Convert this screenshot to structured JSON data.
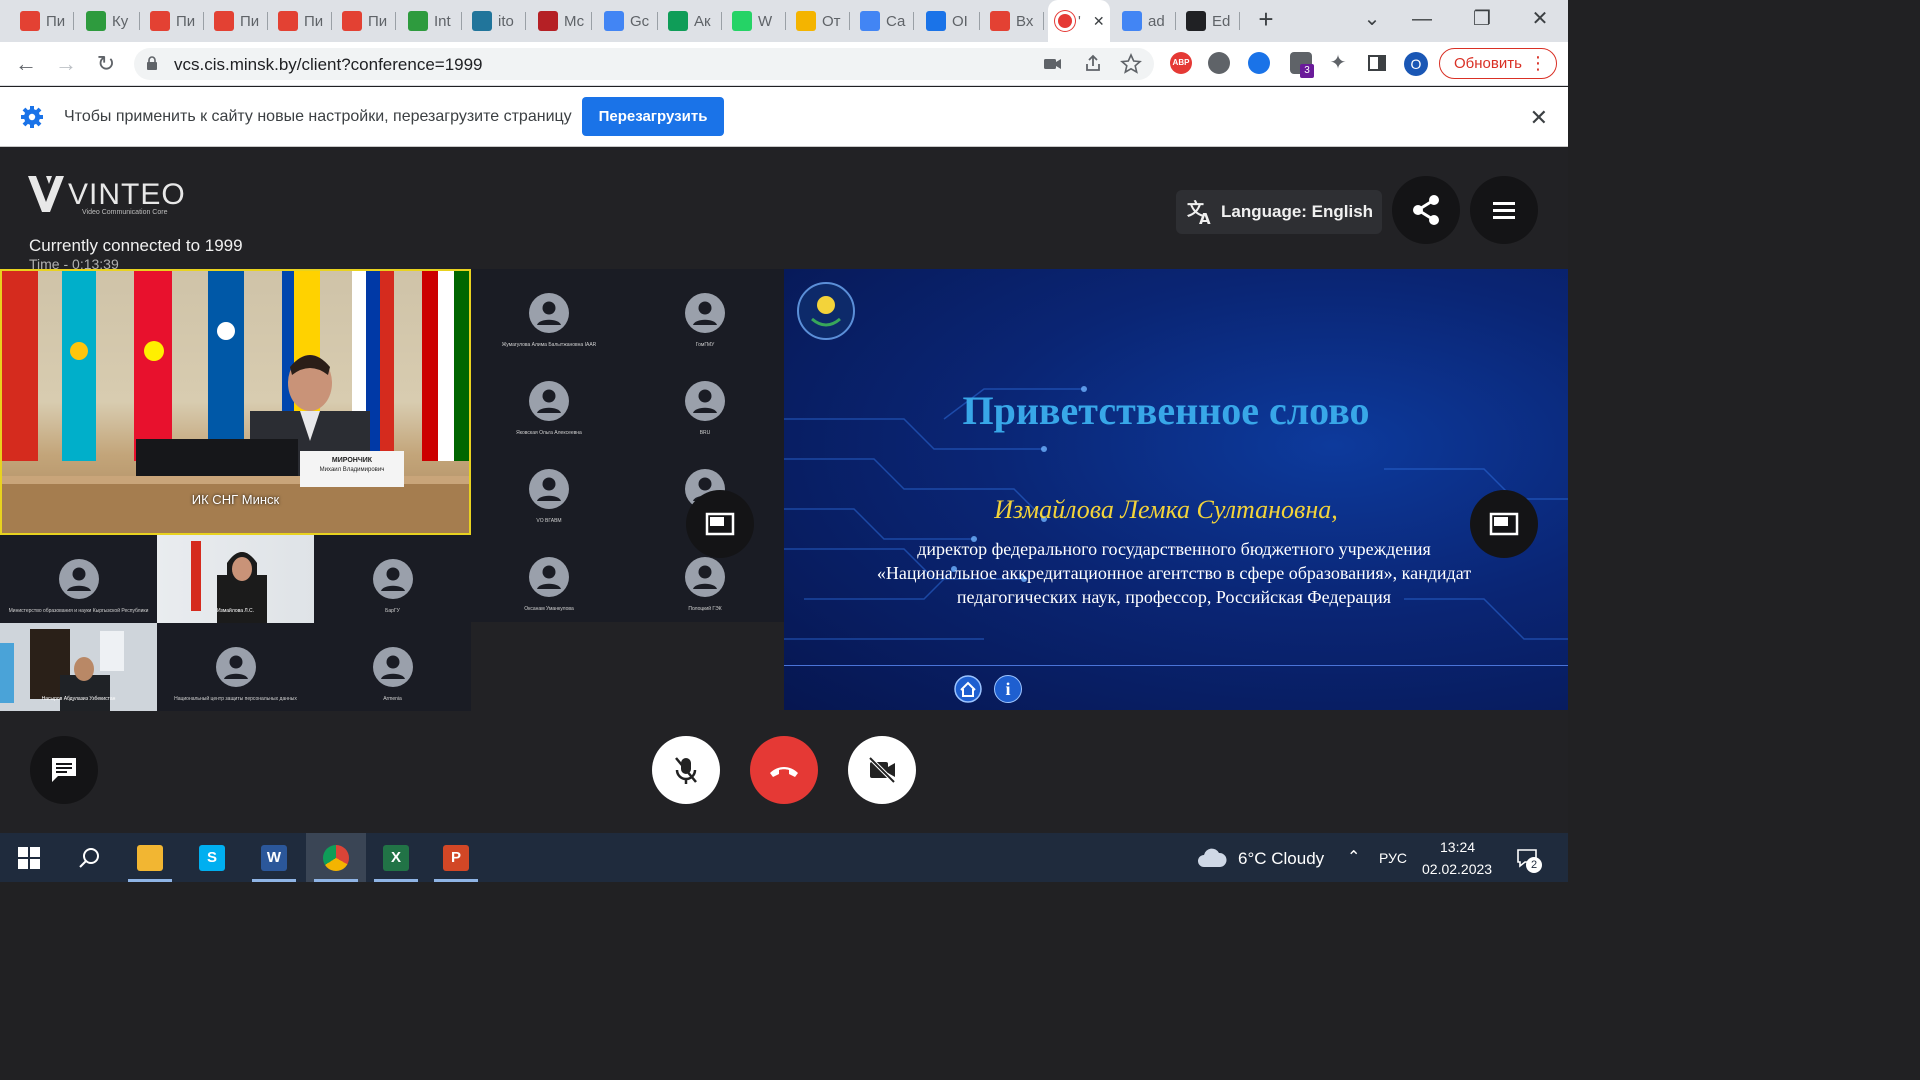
{
  "browser": {
    "tabs": [
      {
        "title": "Пи",
        "icon": "gmail-icon",
        "color": "#e34133"
      },
      {
        "title": "Ку",
        "icon": "flower-icon",
        "color": "#2e9b3e"
      },
      {
        "title": "Пи",
        "icon": "gmail-icon",
        "color": "#e34133"
      },
      {
        "title": "Пи",
        "icon": "gmail-icon",
        "color": "#e34133"
      },
      {
        "title": "Пи",
        "icon": "gmail-icon",
        "color": "#e34133"
      },
      {
        "title": "Пи",
        "icon": "gmail-icon",
        "color": "#e34133"
      },
      {
        "title": "Int",
        "icon": "flower-icon",
        "color": "#2e9b3e"
      },
      {
        "title": "ito",
        "icon": "wordpress-icon",
        "color": "#21759b"
      },
      {
        "title": "Мс",
        "icon": "building-icon",
        "color": "#b52025"
      },
      {
        "title": "Gc",
        "icon": "calendar-icon",
        "color": "#4285f4"
      },
      {
        "title": "Ак",
        "icon": "plus-icon",
        "color": "#0f9d58"
      },
      {
        "title": "W",
        "icon": "whatsapp-icon",
        "color": "#25d366"
      },
      {
        "title": "От",
        "icon": "drive-icon",
        "color": "#f4b400"
      },
      {
        "title": "Са",
        "icon": "docs-icon",
        "color": "#4285f4"
      },
      {
        "title": "ОI",
        "icon": "edge-icon",
        "color": "#1a73e8"
      },
      {
        "title": "Вх",
        "icon": "gmail-icon",
        "color": "#e34133"
      },
      {
        "title": "'",
        "icon": "record-icon",
        "color": "#e53935"
      },
      {
        "title": "ad",
        "icon": "google-icon",
        "color": "#4285f4"
      },
      {
        "title": "Ed",
        "icon": "triangle-icon",
        "color": "#202124"
      }
    ],
    "new_tab": "+",
    "url": "vcs.cis.minsk.by/client?conference=1999",
    "profile_initial": "O",
    "update_label": "Обновить",
    "ext_badge": "3",
    "abp_label": "ABP"
  },
  "infobar": {
    "message": "Чтобы применить к сайту новые настройки, перезагрузите страницу",
    "button": "Перезагрузить",
    "close": "✕"
  },
  "app": {
    "logo_word": "VINTEO",
    "logo_tagline": "Video Communication Core",
    "connected": "Currently connected to 1999",
    "time": "Time - 0:13:39",
    "language": "Language: English",
    "main_video_label": "ИК СНГ Минск",
    "nameplate_line1": "МИРОНЧИК",
    "nameplate_line2": "Михаил Владимирович",
    "grid_participants": [
      "Жумагулова Алима Балытжановна IAAR",
      "ГомГМУ",
      "Яковская Ольга Алексеевна",
      "BRU",
      "VO BГАВМ",
      "",
      "Оксанам Уманкулова",
      "Полоцкий ГЭК"
    ],
    "bottom_participants": [
      "Министерство образования и науки Кыргызской Республики",
      "Измайлова Л.С.",
      "БарГУ",
      "Насыров Абдулазиз Узбекистан",
      "Национальный центр защиты персональных данных",
      "Armenia"
    ],
    "slide": {
      "title": "Приветственное слово",
      "speaker": "Измайлова Лемка Султановна,",
      "desc_lines": [
        "директор федерального государственного бюджетного учреждения",
        "«Национальное аккредитационное агентство в сфере образования», кандидат",
        "педагогических наук, профессор, Российская Федерация"
      ],
      "info_glyph": "i"
    }
  },
  "taskbar": {
    "weather": "6°C  Cloudy",
    "lang": "РУС",
    "time": "13:24",
    "date": "02.02.2023",
    "notifications": "2",
    "apps": [
      {
        "name": "file-explorer",
        "color": "#f2b632",
        "glyph": ""
      },
      {
        "name": "skype",
        "color": "#00aff0",
        "glyph": "S"
      },
      {
        "name": "word",
        "color": "#2b579a",
        "glyph": "W"
      },
      {
        "name": "chrome",
        "color": "#4285f4",
        "glyph": ""
      },
      {
        "name": "excel",
        "color": "#217346",
        "glyph": "X"
      },
      {
        "name": "powerpoint",
        "color": "#d24726",
        "glyph": "P"
      }
    ]
  }
}
